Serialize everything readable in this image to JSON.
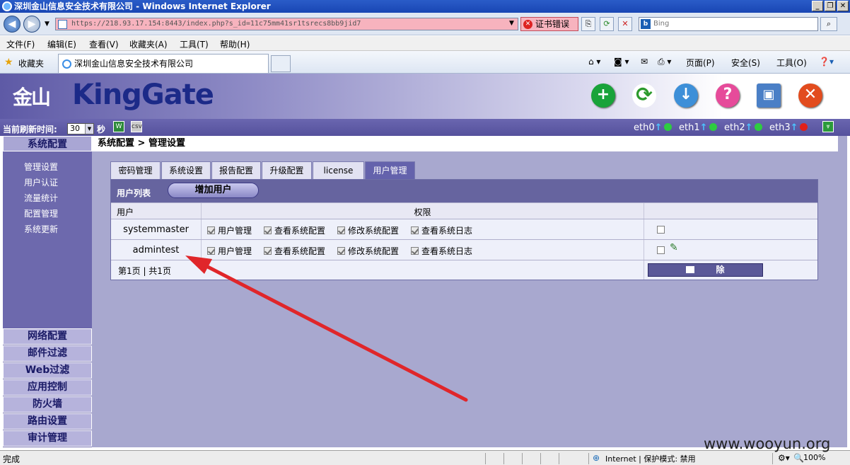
{
  "window": {
    "title": "深圳金山信息安全技术有限公司 - Windows Internet Explorer",
    "controls": [
      "_",
      "❐",
      "✕"
    ]
  },
  "address": {
    "url": "https://218.93.17.154:8443/index.php?s_id=11c75mm41sr1tsrecs8bb9jid7",
    "cert_error": "证书错误",
    "search_placeholder": "Bing"
  },
  "menu": [
    "文件(F)",
    "编辑(E)",
    "查看(V)",
    "收藏夹(A)",
    "工具(T)",
    "帮助(H)"
  ],
  "favbar": {
    "favorites": "收藏夹",
    "tab_title": "深圳金山信息安全技术有限公司",
    "commands": [
      "页面(P)",
      "安全(S)",
      "工具(O)"
    ]
  },
  "app": {
    "logo_cn": "金山",
    "logo_en": "KingGate",
    "header_icons": [
      "add-icon",
      "refresh-icon",
      "download-icon",
      "help-icon",
      "network-icon",
      "close-icon"
    ]
  },
  "strip": {
    "refresh_label": "当前刷新时间:",
    "refresh_value": "30",
    "seconds": "秒",
    "eth": [
      "eth0",
      "eth1",
      "eth2",
      "eth3"
    ],
    "eth_status_colors": [
      "#2ecc40",
      "#2ecc40",
      "#2ecc40",
      "#e0201a"
    ]
  },
  "sidebar": {
    "active_group": "系统配置",
    "sub_items": [
      "管理设置",
      "用户认证",
      "流量统计",
      "配置管理",
      "系统更新"
    ],
    "groups": [
      "网络配置",
      "邮件过滤",
      "Web过滤",
      "应用控制",
      "防火墙",
      "路由设置",
      "审计管理"
    ]
  },
  "main": {
    "breadcrumb": "系统配置 > 管理设置",
    "tabs": [
      "密码管理",
      "系统设置",
      "报告配置",
      "升级配置",
      "license",
      "用户管理"
    ],
    "active_tab": "用户管理",
    "panel_title": "用户列表",
    "add_user": "增加用户",
    "columns": [
      "用户",
      "权限"
    ],
    "users": [
      {
        "name": "systemmaster",
        "perms": [
          "用户管理",
          "查看系统配置",
          "修改系统配置",
          "查看系统日志"
        ],
        "editable": false
      },
      {
        "name": "admintest",
        "perms": [
          "用户管理",
          "查看系统配置",
          "修改系统配置",
          "查看系统日志"
        ],
        "editable": true
      }
    ],
    "pagination": "第1页 | 共1页",
    "delete": "除"
  },
  "status": {
    "left": "完成",
    "zone": "Internet | 保护模式: 禁用",
    "zoom": "100%"
  },
  "watermark": "www.wooyun.org",
  "accent_color": "#e0262a"
}
